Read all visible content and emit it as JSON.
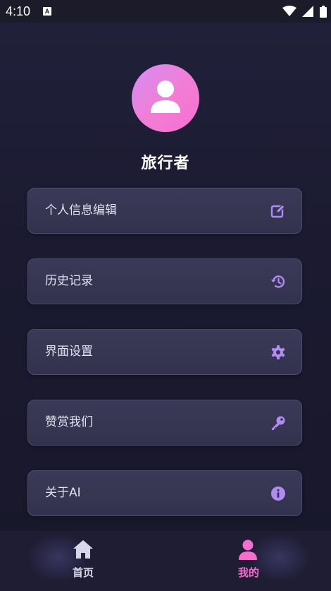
{
  "status_bar": {
    "time": "4:10",
    "indicator": "A",
    "icons": [
      "wifi-icon",
      "signal-icon",
      "battery-icon"
    ]
  },
  "profile": {
    "username": "旅行者",
    "avatar_icon": "person-icon"
  },
  "menu": [
    {
      "label": "个人信息编辑",
      "icon": "edit-icon"
    },
    {
      "label": "历史记录",
      "icon": "history-icon"
    },
    {
      "label": "界面设置",
      "icon": "gear-icon"
    },
    {
      "label": "赞赏我们",
      "icon": "key-icon"
    },
    {
      "label": "关于AI",
      "icon": "info-icon"
    }
  ],
  "bottom_nav": [
    {
      "label": "首页",
      "icon": "home-icon",
      "active": false
    },
    {
      "label": "我的",
      "icon": "person-icon",
      "active": true
    }
  ],
  "colors": {
    "accent": "#b18cf0",
    "active": "#f26fcf",
    "background": "#1b1a2d"
  }
}
